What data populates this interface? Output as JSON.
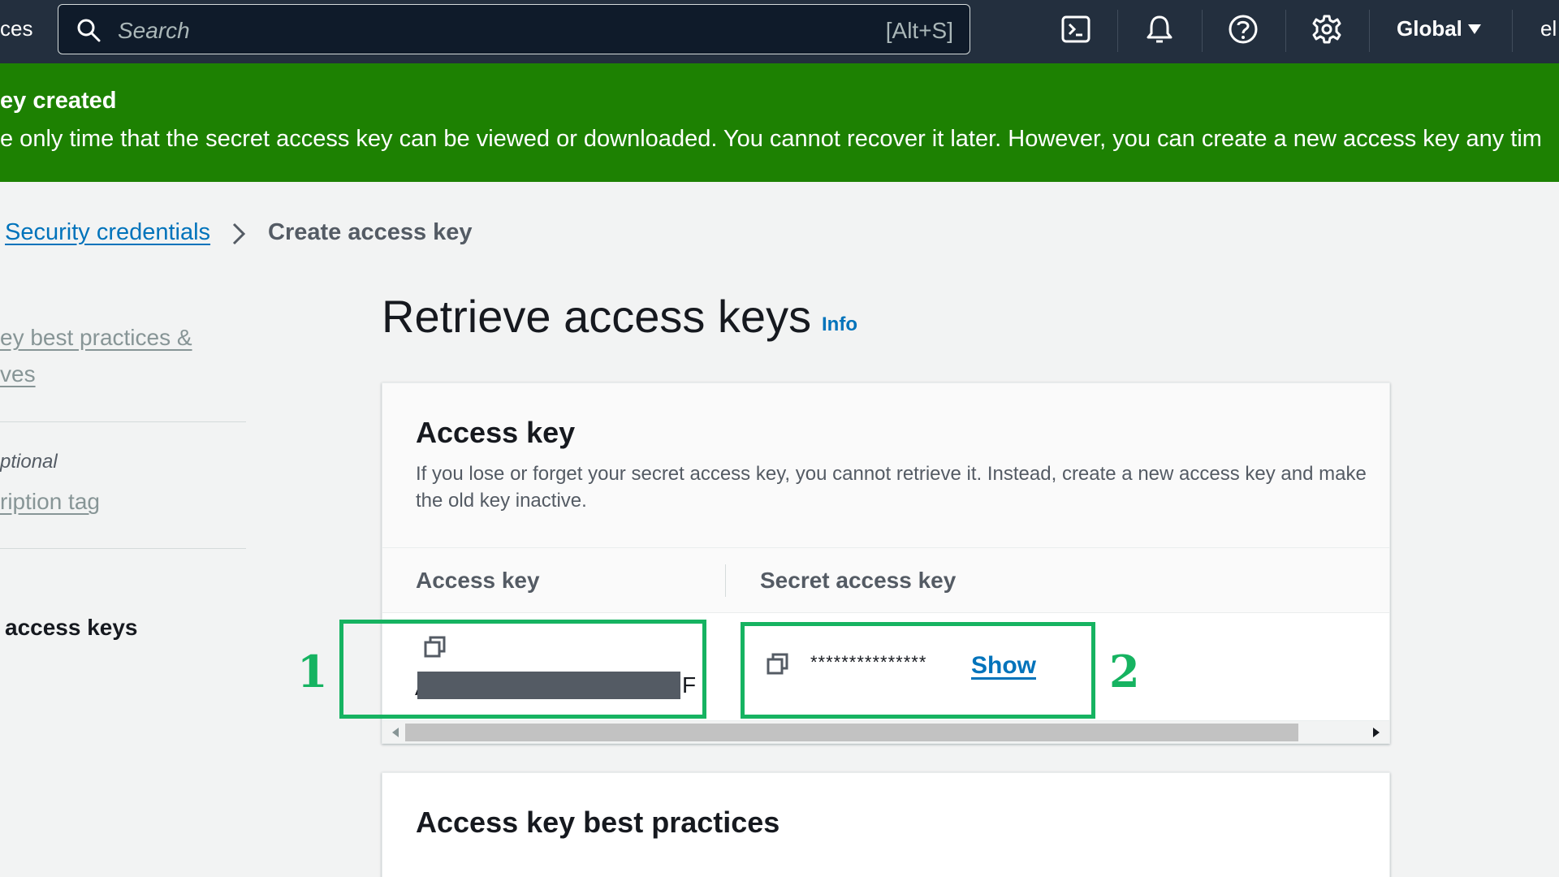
{
  "topnav": {
    "left_text": "ces",
    "search_placeholder": "Search",
    "search_shortcut": "[Alt+S]",
    "region_label": "Global",
    "right_text": "el",
    "icons": [
      "cloudshell-icon",
      "bell-icon",
      "help-icon",
      "gear-icon"
    ]
  },
  "flash": {
    "title": "ey created",
    "message": "e only time that the secret access key can be viewed or downloaded. You cannot recover it later. However, you can create a new access key any tim",
    "color": "#1d8102"
  },
  "breadcrumb": {
    "link": "Security credentials",
    "current": "Create access key"
  },
  "steps": {
    "step1_line1": "ey best practices &",
    "step1_line2": "ves",
    "step2_optional": "ptional",
    "step2_label": "ription tag",
    "step3_label": "access keys"
  },
  "page": {
    "title": "Retrieve access keys",
    "info": "Info"
  },
  "panel": {
    "title": "Access key",
    "description": "If you lose or forget your secret access key, you cannot retrieve it. Instead, create a new access key and make the old key inactive.",
    "columns": [
      "Access key",
      "Secret access key"
    ],
    "access_key_first": "A",
    "access_key_last": "F",
    "secret_masked": "***************",
    "show_label": "Show"
  },
  "annotations": {
    "one": "1",
    "two": "2",
    "color": "#16b361"
  },
  "panel2": {
    "title": "Access key best practices"
  },
  "colors": {
    "nav_bg": "#232f3e",
    "link": "#0073bb",
    "page_bg": "#f2f3f3"
  }
}
